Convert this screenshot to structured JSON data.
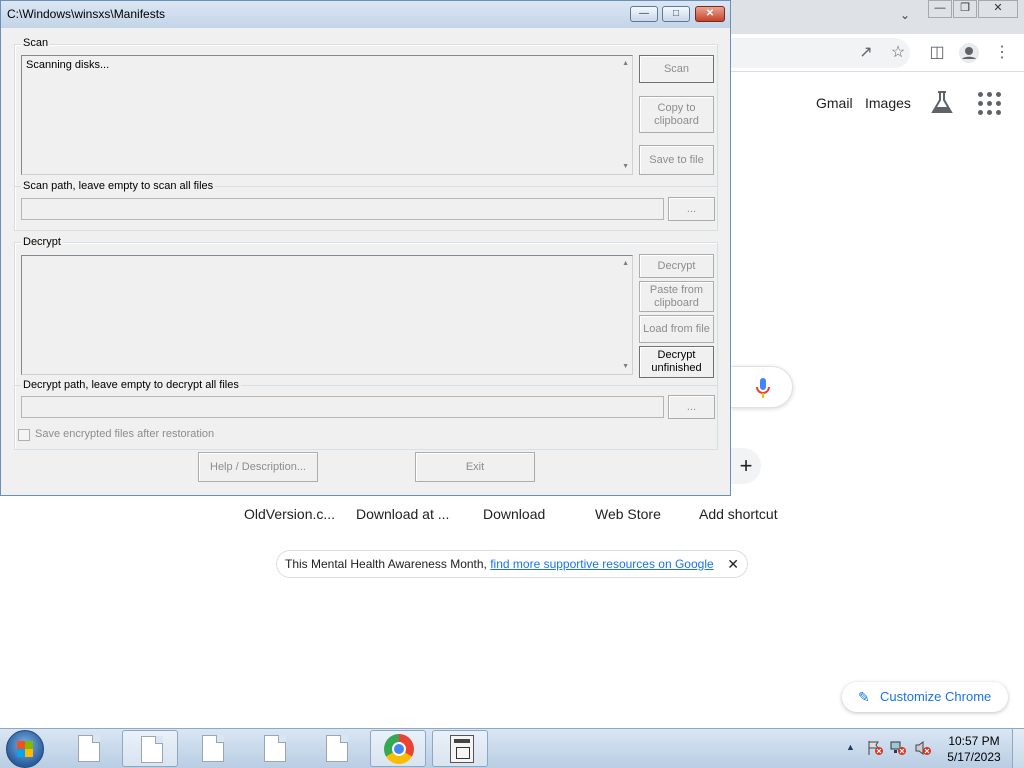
{
  "dialog": {
    "title": "C:\\Windows\\winsxs\\Manifests",
    "scan": {
      "group_label": "Scan",
      "log_text": "Scanning disks...",
      "buttons": {
        "scan": "Scan",
        "copy": "Copy to clipboard",
        "save": "Save to file"
      },
      "path_label": "Scan path, leave empty to scan all files",
      "path_value": "",
      "browse": "..."
    },
    "decrypt": {
      "group_label": "Decrypt",
      "log_text": "",
      "buttons": {
        "decrypt": "Decrypt",
        "paste": "Paste from clipboard",
        "load": "Load from file",
        "unfinished": "Decrypt unfinished"
      },
      "path_label": "Decrypt path, leave empty to decrypt all files",
      "path_value": "",
      "browse": "..."
    },
    "save_encrypted_label": "Save encrypted files after restoration",
    "save_encrypted_checked": false,
    "help_button": "Help / Description...",
    "exit_button": "Exit"
  },
  "chrome": {
    "links": {
      "gmail": "Gmail",
      "images": "Images"
    },
    "shortcuts": [
      "OldVersion.c...",
      "Download at ...",
      "Download",
      "Web Store",
      "Add shortcut"
    ],
    "promo": {
      "text": "This Mental Health Awareness Month, ",
      "link": "find more supportive resources on Google"
    },
    "customize": "Customize Chrome"
  },
  "taskbar": {
    "time": "10:57 PM",
    "date": "5/17/2023"
  }
}
